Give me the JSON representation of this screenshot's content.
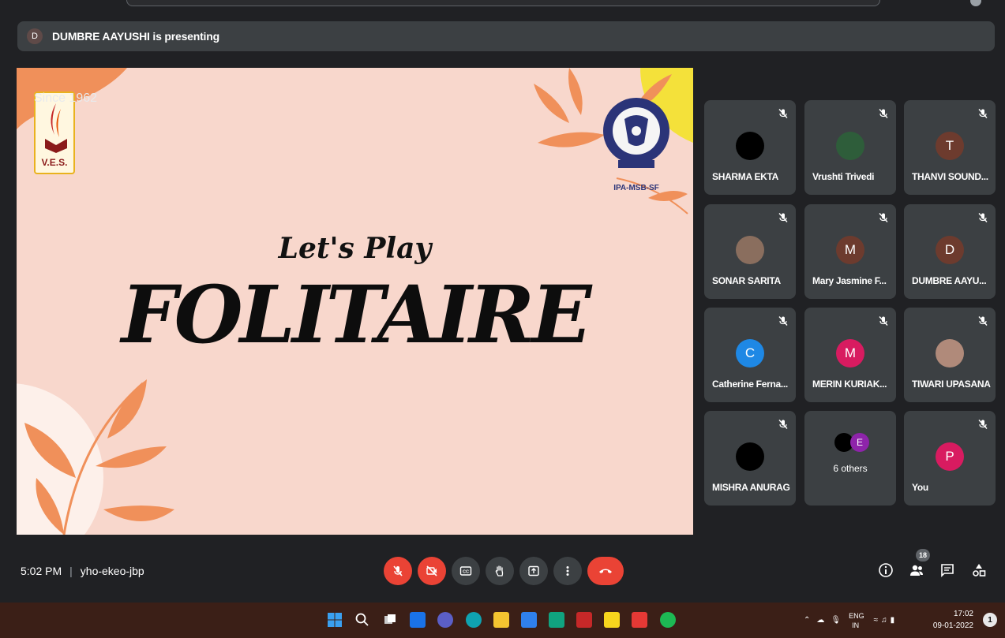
{
  "presenting": {
    "avatar_letter": "D",
    "text": "DUMBRE AAYUSHI is presenting"
  },
  "slide": {
    "logo_left": {
      "name": "V.E.S.",
      "since": "Since 1962"
    },
    "logo_right": {
      "label": "IPA-MSB-SF"
    },
    "title_small": "Let's Play",
    "title_big": "FOLITAIRE"
  },
  "participants": [
    {
      "name": "SHARMA EKTA",
      "avatar": "",
      "avatar_color": "#000000",
      "muted": true
    },
    {
      "name": "Vrushti Trivedi",
      "avatar": "",
      "avatar_color": "#2e5d3a",
      "muted": true
    },
    {
      "name": "THANVI SOUND...",
      "avatar": "T",
      "avatar_color": "#6d3b2e",
      "muted": true
    },
    {
      "name": "SONAR SARITA",
      "avatar": "",
      "avatar_color": "#8a6e5e",
      "muted": true
    },
    {
      "name": "Mary Jasmine F...",
      "avatar": "M",
      "avatar_color": "#6d3b2e",
      "muted": true
    },
    {
      "name": "DUMBRE AAYU...",
      "avatar": "D",
      "avatar_color": "#6d3b2e",
      "muted": true
    },
    {
      "name": "Catherine Ferna...",
      "avatar": "C",
      "avatar_color": "#1e88e5",
      "muted": true
    },
    {
      "name": "MERIN KURIAK...",
      "avatar": "M",
      "avatar_color": "#d81b60",
      "muted": true
    },
    {
      "name": "TIWARI UPASANA",
      "avatar": "",
      "avatar_color": "#b08a7a",
      "muted": true
    },
    {
      "name": "MISHRA ANURAG",
      "avatar": "",
      "avatar_color": "#000000",
      "muted": true
    },
    {
      "name": "6 others",
      "avatar": "E",
      "avatar_color": "#8e24aa",
      "muted": false
    },
    {
      "name": "You",
      "avatar": "P",
      "avatar_color": "#d81b60",
      "muted": true
    }
  ],
  "meeting": {
    "time": "5:02 PM",
    "code": "yho-ekeo-jbp",
    "people_count": "18"
  },
  "taskbar": {
    "lang_top": "ENG",
    "lang_bottom": "IN",
    "time": "17:02",
    "date": "09-01-2022",
    "notification_count": "1"
  },
  "colors": {
    "slide_bg": "#f8d7cc",
    "leaf": "#f0905a",
    "end_call": "#ea4335",
    "tile_bg": "#3c4043"
  }
}
